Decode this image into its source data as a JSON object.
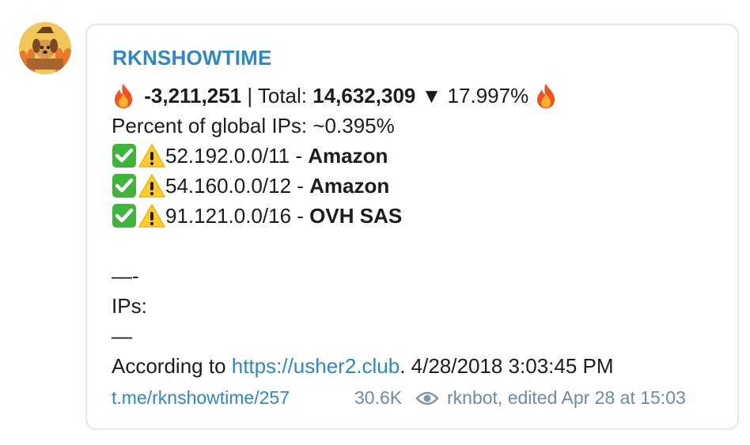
{
  "channel": {
    "name": "RKNSHOWTIME"
  },
  "message": {
    "delta": "-3,211,251",
    "separator": " | Total: ",
    "total": "14,632,309",
    "change": " ▼ 17.997% ",
    "percent_line": "Percent of global IPs: ~0.395%",
    "ranges": [
      {
        "cidr": "52.192.0.0/11",
        "dash": " - ",
        "owner": "Amazon"
      },
      {
        "cidr": "54.160.0.0/12",
        "dash": " - ",
        "owner": "Amazon"
      },
      {
        "cidr": "91.121.0.0/16",
        "dash": " - ",
        "owner": "OVH SAS"
      }
    ],
    "divider1": "—-",
    "ips_label": "IPs:",
    "divider2": "—",
    "according_prefix": "According to ",
    "according_link": "https://usher2.club",
    "according_suffix": ". 4/28/2018 3:03:45 PM"
  },
  "footer": {
    "post_link": "t.me/rknshowtime/257",
    "views": "30.6K",
    "author_edited": "rknbot, edited  Apr 28 at 15:03"
  },
  "icons": {
    "fire": "fire-icon",
    "check": "check-mark-button-icon",
    "warning": "warning-icon",
    "eye": "eye-icon"
  },
  "colors": {
    "accent": "#2e87c6",
    "meta": "#6f8aa3",
    "bubble_border": "#dde8ef"
  }
}
